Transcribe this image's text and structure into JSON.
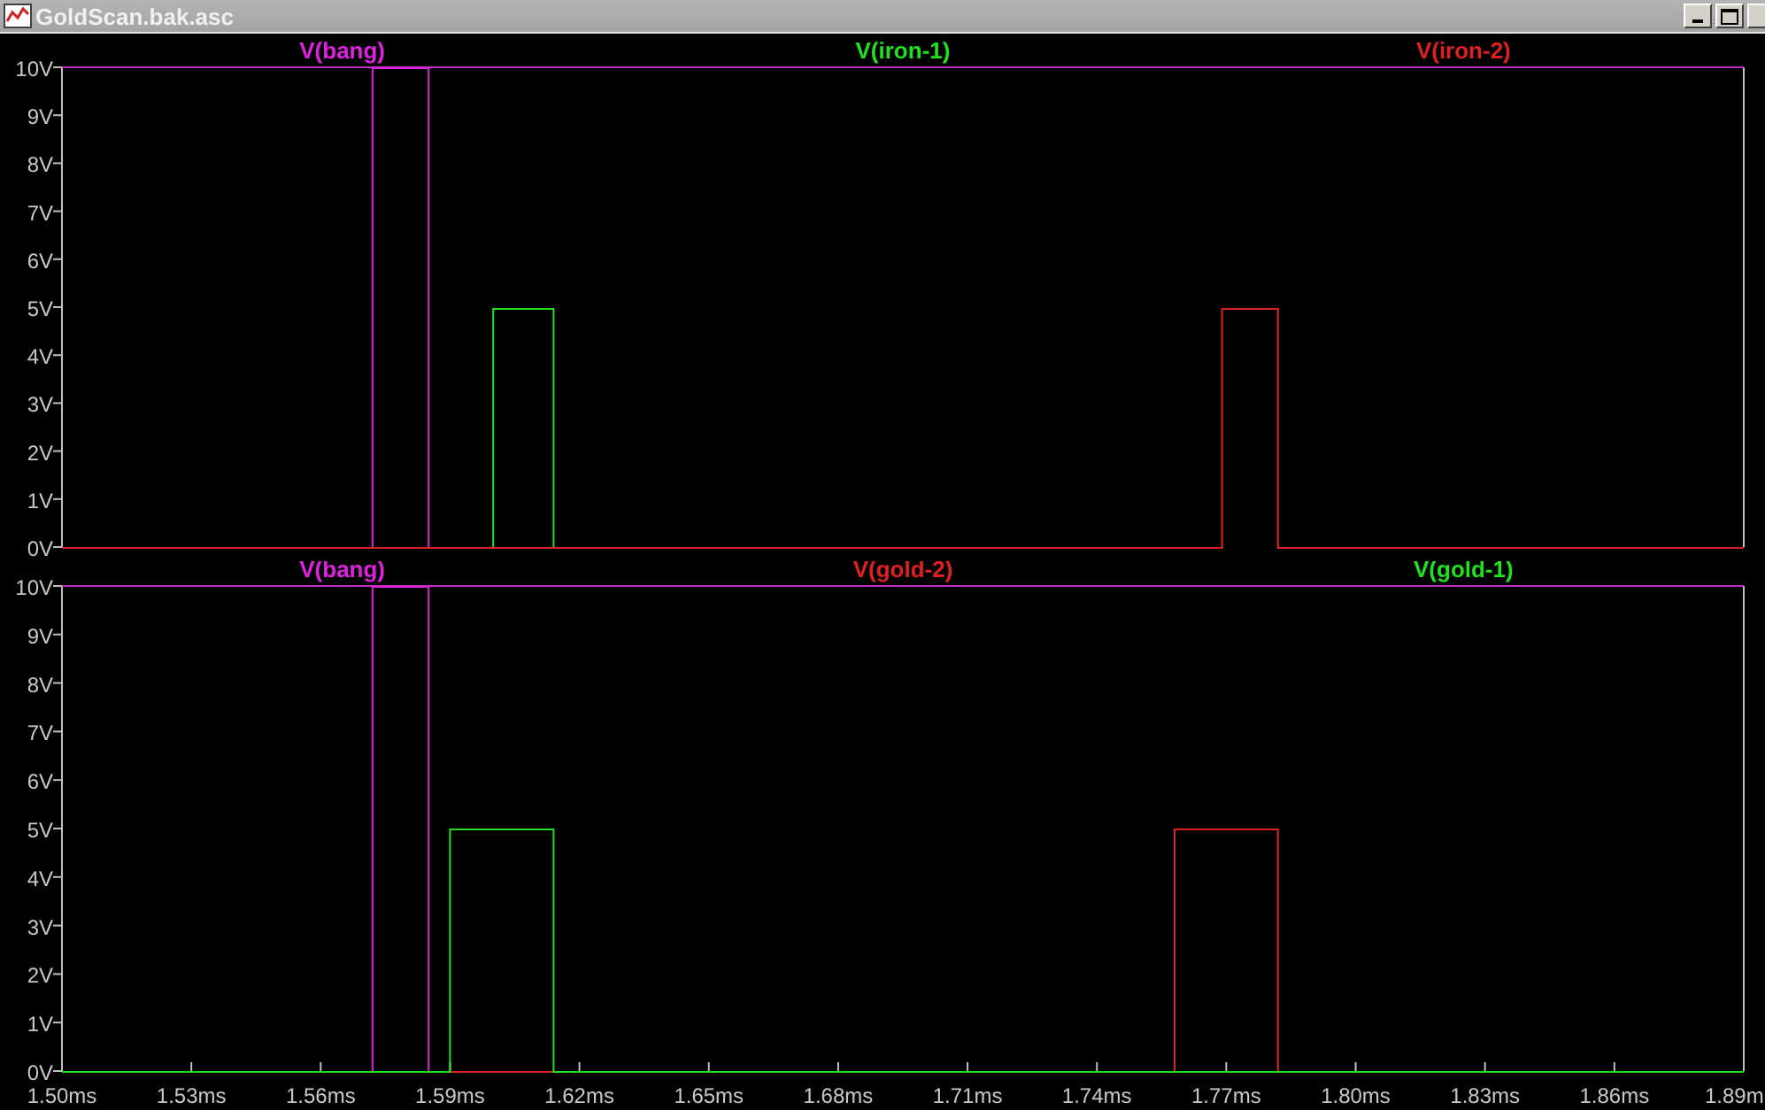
{
  "window": {
    "title": "GoldScan.bak.asc"
  },
  "panes": [
    {
      "chart_data": {
        "type": "line",
        "x": [
          1.5,
          1.572,
          1.572,
          1.585,
          1.585,
          1.6,
          1.6,
          1.614,
          1.614,
          1.769,
          1.769,
          1.782,
          1.782,
          1.89
        ],
        "xlim": [
          1.5,
          1.89
        ],
        "ylim": [
          0,
          10
        ],
        "yticks": [
          {
            "value": 0,
            "label": "0V"
          },
          {
            "value": 1,
            "label": "1V"
          },
          {
            "value": 2,
            "label": "2V"
          },
          {
            "value": 3,
            "label": "3V"
          },
          {
            "value": 4,
            "label": "4V"
          },
          {
            "value": 5,
            "label": "5V"
          },
          {
            "value": 6,
            "label": "6V"
          },
          {
            "value": 7,
            "label": "7V"
          },
          {
            "value": 8,
            "label": "8V"
          },
          {
            "value": 9,
            "label": "9V"
          },
          {
            "value": 10,
            "label": "10V"
          }
        ],
        "series": [
          {
            "name": "V(bang)",
            "color": "#e020e0",
            "values": [
              null,
              0,
              10,
              10,
              0,
              null,
              null,
              null,
              null,
              null,
              null,
              null,
              null,
              null
            ]
          },
          {
            "name": "V(iron-1)",
            "color": "#20e020",
            "values": [
              null,
              null,
              null,
              null,
              null,
              0,
              5,
              5,
              0,
              null,
              null,
              null,
              null,
              null
            ]
          },
          {
            "name": "V(iron-2)",
            "color": "#e02020",
            "values": [
              0,
              0,
              0,
              0,
              0,
              0,
              0,
              0,
              0,
              0,
              5,
              5,
              0,
              0
            ]
          }
        ]
      }
    },
    {
      "chart_data": {
        "type": "line",
        "x": [
          1.5,
          1.572,
          1.572,
          1.585,
          1.585,
          1.59,
          1.59,
          1.614,
          1.614,
          1.758,
          1.758,
          1.782,
          1.782,
          1.89
        ],
        "xlim": [
          1.5,
          1.89
        ],
        "ylim": [
          0,
          10
        ],
        "yticks": [
          {
            "value": 0,
            "label": "0V"
          },
          {
            "value": 1,
            "label": "1V"
          },
          {
            "value": 2,
            "label": "2V"
          },
          {
            "value": 3,
            "label": "3V"
          },
          {
            "value": 4,
            "label": "4V"
          },
          {
            "value": 5,
            "label": "5V"
          },
          {
            "value": 6,
            "label": "6V"
          },
          {
            "value": 7,
            "label": "7V"
          },
          {
            "value": 8,
            "label": "8V"
          },
          {
            "value": 9,
            "label": "9V"
          },
          {
            "value": 10,
            "label": "10V"
          }
        ],
        "xticks": [
          {
            "value": 1.5,
            "label": "1.50ms"
          },
          {
            "value": 1.53,
            "label": "1.53ms"
          },
          {
            "value": 1.56,
            "label": "1.56ms"
          },
          {
            "value": 1.59,
            "label": "1.59ms"
          },
          {
            "value": 1.62,
            "label": "1.62ms"
          },
          {
            "value": 1.65,
            "label": "1.65ms"
          },
          {
            "value": 1.68,
            "label": "1.68ms"
          },
          {
            "value": 1.71,
            "label": "1.71ms"
          },
          {
            "value": 1.74,
            "label": "1.74ms"
          },
          {
            "value": 1.77,
            "label": "1.77ms"
          },
          {
            "value": 1.8,
            "label": "1.80ms"
          },
          {
            "value": 1.83,
            "label": "1.83ms"
          },
          {
            "value": 1.86,
            "label": "1.86ms"
          },
          {
            "value": 1.89,
            "label": "1.89m"
          }
        ],
        "series": [
          {
            "name": "V(bang)",
            "color": "#e020e0",
            "values": [
              null,
              0,
              10,
              10,
              0,
              null,
              null,
              null,
              null,
              null,
              null,
              null,
              null,
              null
            ]
          },
          {
            "name": "V(gold-2)",
            "color": "#e02020",
            "values": [
              null,
              null,
              null,
              null,
              null,
              0,
              0,
              0,
              0,
              0,
              5,
              5,
              0,
              null
            ]
          },
          {
            "name": "V(gold-1)",
            "color": "#20e020",
            "values": [
              0,
              0,
              0,
              0,
              0,
              0,
              5,
              5,
              0,
              0,
              0,
              0,
              0,
              0
            ]
          }
        ]
      }
    }
  ]
}
